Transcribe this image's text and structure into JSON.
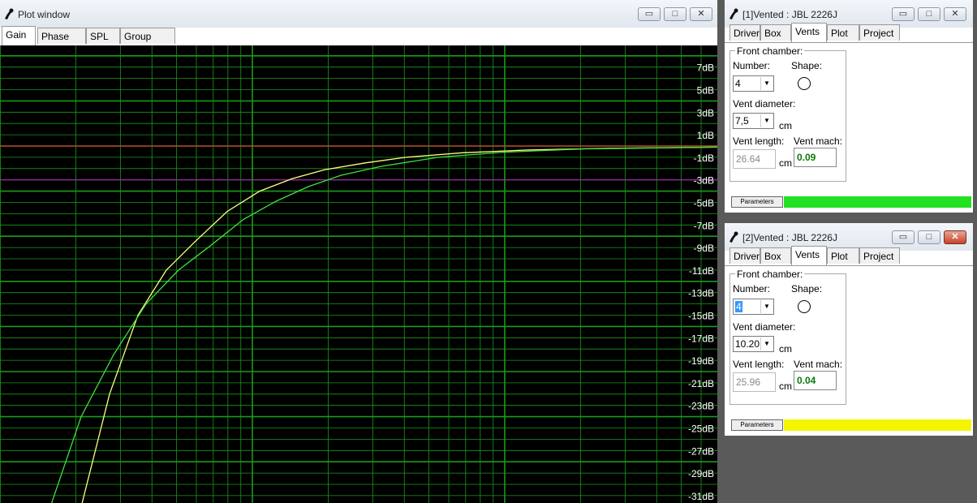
{
  "plot_window": {
    "title": "Plot window",
    "tabs": [
      {
        "label": "Gain",
        "active": true
      },
      {
        "label": "Phase plot",
        "active": false
      },
      {
        "label": "SPL",
        "active": false
      },
      {
        "label": "Group delay",
        "active": false
      }
    ],
    "buttons": {
      "minimize": "▭",
      "maximize": "□",
      "close": "✕"
    }
  },
  "chart_data": {
    "type": "line",
    "y_tick_labels": [
      "7dB",
      "5dB",
      "3dB",
      "1dB",
      "-1dB",
      "-3dB",
      "-5dB",
      "-7dB",
      "-9dB",
      "-11dB",
      "-13dB",
      "-15dB",
      "-17dB",
      "-19dB",
      "-21dB",
      "-23dB",
      "-25dB",
      "-27dB",
      "-29dB",
      "-31dB"
    ],
    "ylim": [
      -32,
      8
    ],
    "reference_line_db": 0,
    "reference_color": "#ff3030",
    "minus3_line_db": -3,
    "minus3_color": "#c020c0",
    "grid_color": "#1a9a1a",
    "background": "#000000",
    "series": [
      {
        "color": "#ffff80",
        "points": [
          [
            100,
            -32
          ],
          [
            135,
            -22
          ],
          [
            170,
            -15
          ],
          [
            205,
            -11
          ],
          [
            240,
            -8.5
          ],
          [
            280,
            -5.8
          ],
          [
            320,
            -4.0
          ],
          [
            360,
            -2.9
          ],
          [
            400,
            -2.1
          ],
          [
            450,
            -1.5
          ],
          [
            500,
            -1.0
          ],
          [
            570,
            -0.6
          ],
          [
            650,
            -0.35
          ],
          [
            750,
            -0.2
          ],
          [
            884,
            -0.1
          ]
        ]
      },
      {
        "color": "#40e040",
        "points": [
          [
            62,
            -32
          ],
          [
            100,
            -24
          ],
          [
            140,
            -18.5
          ],
          [
            180,
            -14
          ],
          [
            220,
            -11
          ],
          [
            260,
            -8.8
          ],
          [
            300,
            -6.5
          ],
          [
            340,
            -4.9
          ],
          [
            380,
            -3.6
          ],
          [
            420,
            -2.6
          ],
          [
            470,
            -1.8
          ],
          [
            540,
            -1.0
          ],
          [
            620,
            -0.55
          ],
          [
            720,
            -0.25
          ],
          [
            884,
            -0.1
          ]
        ]
      }
    ]
  },
  "vented_windows": [
    {
      "title": "[1]Vented : JBL 2226J",
      "tabs": [
        {
          "label": "Driver",
          "active": false
        },
        {
          "label": "Box",
          "active": false
        },
        {
          "label": "Vents",
          "active": true
        },
        {
          "label": "Plot",
          "active": false
        },
        {
          "label": "Project",
          "active": false
        }
      ],
      "front_chamber_label": "Front chamber:",
      "number_label": "Number:",
      "number_value": "4",
      "number_selected": false,
      "shape_label": "Shape:",
      "shape_icon": "circle-shape-icon",
      "vent_diameter_label": "Vent diameter:",
      "vent_diameter_value": "7,5",
      "diameter_unit": "cm",
      "vent_length_label": "Vent length:",
      "vent_length_value": "26.64",
      "length_unit": "cm",
      "vent_mach_label": "Vent mach:",
      "vent_mach_value": "0.09",
      "parameters_label": "Parameters",
      "status_color": "#22e022",
      "buttons": {
        "minimize": "▭",
        "maximize": "□",
        "close": "✕"
      }
    },
    {
      "title": "[2]Vented : JBL 2226J",
      "tabs": [
        {
          "label": "Driver",
          "active": false
        },
        {
          "label": "Box",
          "active": false
        },
        {
          "label": "Vents",
          "active": true
        },
        {
          "label": "Plot",
          "active": false
        },
        {
          "label": "Project",
          "active": false
        }
      ],
      "front_chamber_label": "Front chamber:",
      "number_label": "Number:",
      "number_value": "4",
      "number_selected": true,
      "shape_label": "Shape:",
      "shape_icon": "circle-shape-icon",
      "vent_diameter_label": "Vent diameter:",
      "vent_diameter_value": "10.20",
      "diameter_unit": "cm",
      "vent_length_label": "Vent length:",
      "vent_length_value": "25.96",
      "length_unit": "cm",
      "vent_mach_label": "Vent mach:",
      "vent_mach_value": "0.04",
      "parameters_label": "Parameters",
      "status_color": "#f5f500",
      "buttons": {
        "minimize": "▭",
        "maximize": "□",
        "close": "✕"
      }
    }
  ]
}
